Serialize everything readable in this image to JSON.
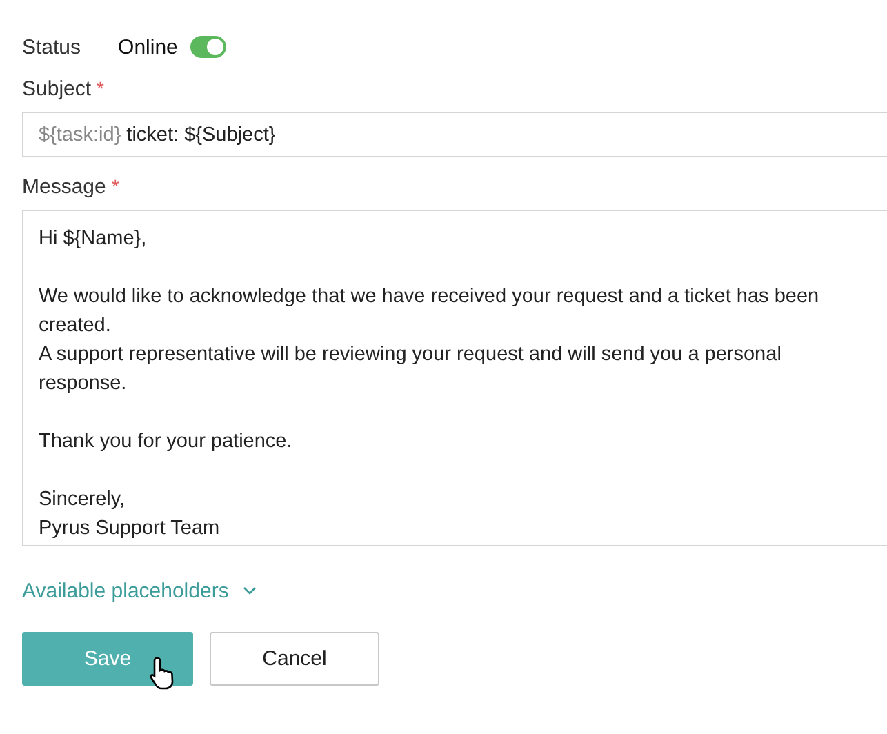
{
  "status": {
    "label": "Status",
    "value": "Online",
    "on": true
  },
  "subject": {
    "label": "Subject",
    "required_mark": "*",
    "token": "${task:id}",
    "text": "ticket: ${Subject}"
  },
  "message": {
    "label": "Message",
    "required_mark": "*",
    "paragraphs": [
      [
        "Hi ${Name},"
      ],
      [
        "We would like to acknowledge that we have received your request and a ticket has been",
        "created.",
        "A support representative will be reviewing your request and will send you a personal",
        "response."
      ],
      [
        "Thank you for your patience."
      ],
      [
        "Sincerely,",
        "Pyrus Support Team"
      ]
    ]
  },
  "placeholders_link": {
    "label": "Available placeholders",
    "expanded": false
  },
  "buttons": [
    {
      "label": "Save",
      "kind": "primary"
    },
    {
      "label": "Cancel",
      "kind": "secondary"
    }
  ]
}
